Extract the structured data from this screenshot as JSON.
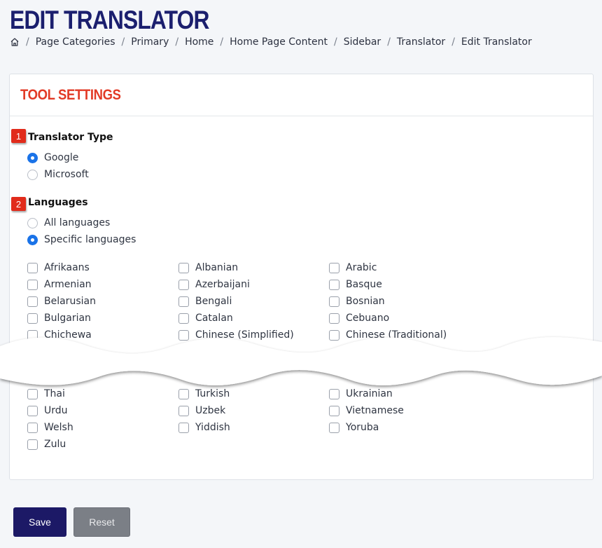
{
  "page": {
    "title": "EDIT TRANSLATOR"
  },
  "breadcrumb": {
    "home_icon": "home-icon",
    "items": [
      "Page Categories",
      "Primary",
      "Home",
      "Home Page Content",
      "Sidebar",
      "Translator",
      "Edit Translator"
    ]
  },
  "card": {
    "title": "TOOL SETTINGS"
  },
  "translator_type": {
    "badge": "1",
    "label": "Translator Type",
    "options": [
      {
        "label": "Google",
        "checked": true
      },
      {
        "label": "Microsoft",
        "checked": false
      }
    ]
  },
  "languages": {
    "badge": "2",
    "label": "Languages",
    "options": [
      {
        "label": "All languages",
        "checked": false
      },
      {
        "label": "Specific languages",
        "checked": true
      }
    ],
    "list_top": [
      [
        "Afrikaans",
        "Albanian",
        "Arabic"
      ],
      [
        "Armenian",
        "Azerbaijani",
        "Basque"
      ],
      [
        "Belarusian",
        "Bengali",
        "Bosnian"
      ],
      [
        "Bulgarian",
        "Catalan",
        "Cebuano"
      ],
      [
        "Chichewa",
        "Chinese (Simplified)",
        "Chinese (Traditional)"
      ]
    ],
    "list_bottom": [
      [
        "Thai",
        "Turkish",
        "Ukrainian"
      ],
      [
        "Urdu",
        "Uzbek",
        "Vietnamese"
      ],
      [
        "Welsh",
        "Yiddish",
        "Yoruba"
      ],
      [
        "Zulu"
      ]
    ]
  },
  "actions": {
    "save_label": "Save",
    "reset_label": "Reset"
  },
  "colors": {
    "title": "#1b1f6e",
    "card_title": "#e23a26",
    "badge": "#e12b1b",
    "radio_checked": "#1a73e8",
    "save_button": "#1c1966",
    "reset_button": "#7b7f86"
  }
}
